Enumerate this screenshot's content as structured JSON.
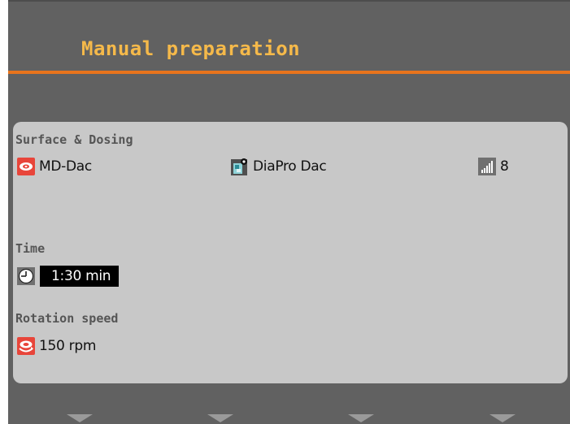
{
  "screen": {
    "title": "Manual preparation"
  },
  "surface_dosing": {
    "label": "Surface & Dosing",
    "surface": "MD-Dac",
    "suspension": "DiaPro Dac",
    "dosing_level": "8"
  },
  "time": {
    "label": "Time",
    "value": "1:30 min"
  },
  "rotation": {
    "label": "Rotation speed",
    "value": "150 rpm"
  },
  "icons": {
    "surface": "surface-disc-icon",
    "suspension": "suspension-bottle-icon",
    "dosing": "dosing-level-icon",
    "clock": "clock-icon",
    "rotation": "rotation-speed-icon",
    "softkey": "softkey-arrow-icon"
  },
  "colors": {
    "background": "#616161",
    "title": "#f5b94a",
    "accent_line": "#e8741c",
    "panel": "#c8c8c8",
    "label": "#555555",
    "icon_red": "#e8453a",
    "softkey": "#9a9a9a"
  }
}
